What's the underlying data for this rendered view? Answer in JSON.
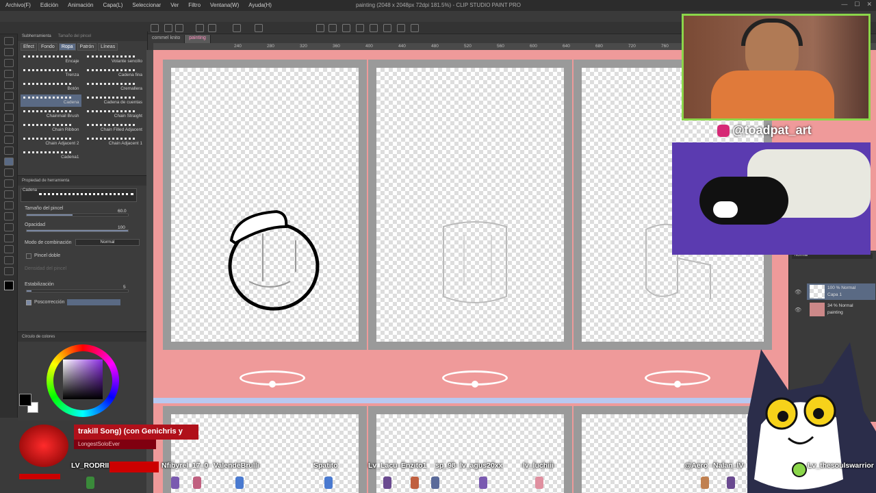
{
  "window": {
    "title": "painting (2048 x 2048px 72dpi 181.5%) - CLIP STUDIO PAINT PRO"
  },
  "menu": [
    "Archivo(F)",
    "Edición",
    "Animación",
    "Capa(L)",
    "Seleccionar",
    "Ver",
    "Filtro",
    "Ventana(W)",
    "Ayuda(H)"
  ],
  "doc_tabs": [
    "commel knito",
    "painting"
  ],
  "ruler_ticks": [
    "240",
    "280",
    "320",
    "360",
    "400",
    "440",
    "480",
    "520",
    "560",
    "600",
    "640",
    "680",
    "720",
    "760"
  ],
  "subtool": {
    "panel_title": "Subherramienta",
    "panel_title2": "Tamaño del pincel",
    "tabs": [
      "Efect",
      "Fondo",
      "Ropa",
      "Patrón",
      "Líneas"
    ],
    "active_tab_index": 2,
    "brushes": [
      [
        "Encaje",
        "Volante sencillo"
      ],
      [
        "Trenza",
        "Cadena fina"
      ],
      [
        "Botón",
        "Cremallera"
      ],
      [
        "Cadena",
        "Cadena de cuentas"
      ],
      [
        "Chainmail Brush",
        "Chain Straight"
      ],
      [
        "Chain Ribbon",
        "Chain Filled Adjacent"
      ],
      [
        "Chain Adjacent 2",
        "Chain Adjacent 1"
      ],
      [
        "Cadena1",
        ""
      ]
    ],
    "selected_brush": "Cadena"
  },
  "tool_property": {
    "title": "Propiedad de herramienta",
    "tool_name": "Cadena",
    "brush_size_label": "Tamaño del pincel",
    "brush_size_value": "60.0",
    "brush_size_fraction": 0.45,
    "opacity_label": "Opacidad",
    "opacity_value": "100",
    "blend_label": "Modo de combinación",
    "blend_value": "Normal",
    "double_brush_label": "Pincel doble",
    "brush_density_label": "Densidad del pincel",
    "stabilization_label": "Estabilización",
    "stabilization_value": "5",
    "postcorrection_label": "Poscorrección"
  },
  "color_panel": {
    "title": "Círculo de colores",
    "main_color": "#000000",
    "sub_color": "#ffffff",
    "hue_color": "#8a2be2"
  },
  "layers": {
    "mode": "Normal",
    "items": [
      {
        "opacity_mode": "100 % Normal",
        "name": "Capa 1",
        "selected": true
      },
      {
        "opacity_mode": "34 % Normal",
        "name": "painting",
        "selected": false
      }
    ]
  },
  "overlay": {
    "handle": "@toadpat_art",
    "now_playing_title": "trakill Song) (con Genichris y",
    "now_playing_artist": "LongestSoloEver",
    "chat_names": [
      "LV_RODRII",
      "Nfibyrel_17_0",
      "ValendeBrulli",
      "Spatito",
      "Lv_Lacu",
      "Enzito1",
      "sp_98",
      "lv_agus20xx",
      "lv_luchiii",
      "@Aero",
      "Nalan_lV",
      "Lv_thesoulswarrior"
    ]
  },
  "colors": {
    "canvas_bg": "#ef9a9a",
    "frame": "#9a9a9a",
    "accent": "#5a6a84",
    "webcam_border": "#8bd64a"
  }
}
